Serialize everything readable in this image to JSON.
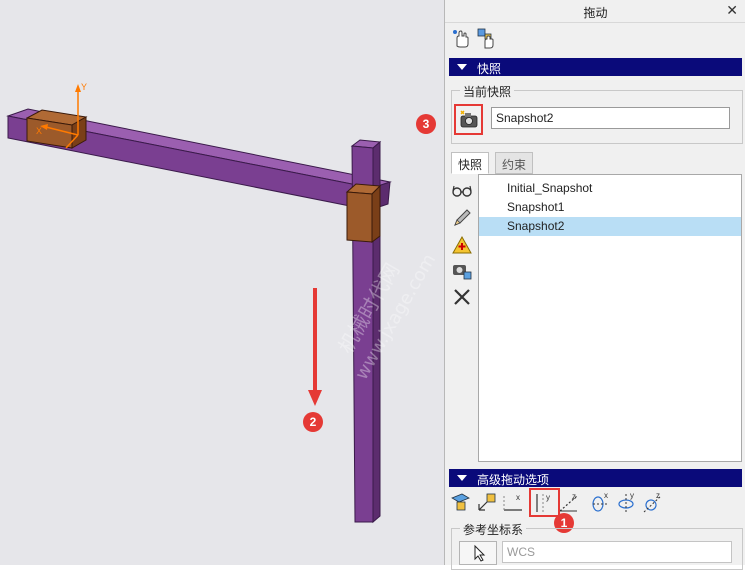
{
  "dialog": {
    "title": "拖动",
    "close_glyph": "✕"
  },
  "toolbar": {
    "items": [
      {
        "icon": "hand-drag-point-icon"
      },
      {
        "icon": "hand-drag-body-icon"
      }
    ]
  },
  "snapshots_section": {
    "title": "快照",
    "current_group_label": "当前快照",
    "current_name": "Snapshot2",
    "tabs": [
      {
        "label": "快照",
        "active": true
      },
      {
        "label": "约束",
        "active": false
      }
    ],
    "list": [
      {
        "name": "Initial_Snapshot",
        "selected": false
      },
      {
        "name": "Snapshot1",
        "selected": false
      },
      {
        "name": "Snapshot2",
        "selected": true
      }
    ],
    "side_icons": [
      "glasses-view-icon",
      "pencil-edit-icon",
      "warning-add-icon",
      "camera-copy-icon",
      "delete-x-icon"
    ]
  },
  "advanced_section": {
    "title": "高级拖动选项",
    "axis_buttons": [
      {
        "icon": "plane-drag-icon",
        "letter": ""
      },
      {
        "icon": "plane-normal-icon",
        "letter": ""
      },
      {
        "icon": "translate-x-icon",
        "letter": "x"
      },
      {
        "icon": "translate-y-icon",
        "letter": "y"
      },
      {
        "icon": "translate-z-icon",
        "letter": "z"
      },
      {
        "icon": "rotate-x-icon",
        "letter": "x"
      },
      {
        "icon": "rotate-y-icon",
        "letter": "y"
      },
      {
        "icon": "rotate-z-icon",
        "letter": "z"
      }
    ],
    "ref_group_label": "参考坐标系",
    "ref_value": "WCS"
  },
  "annotations": {
    "badge_1": "1",
    "badge_2": "2",
    "badge_3": "3"
  },
  "viewport": {
    "watermark_line1": "机械时代网",
    "watermark_line2": "www.jxage.com",
    "coord_label_y": "Y",
    "coord_label_x": "X",
    "colors": {
      "beam_top": "#9b5fb0",
      "beam_front": "#7a3f91",
      "beam_side": "#5c2c6e",
      "slider_face": "#9c5a2a",
      "slider_side": "#7a3f18",
      "accent_red": "#e53935",
      "header_blue": "#0a0a7a",
      "selection": "#b9def5"
    }
  }
}
